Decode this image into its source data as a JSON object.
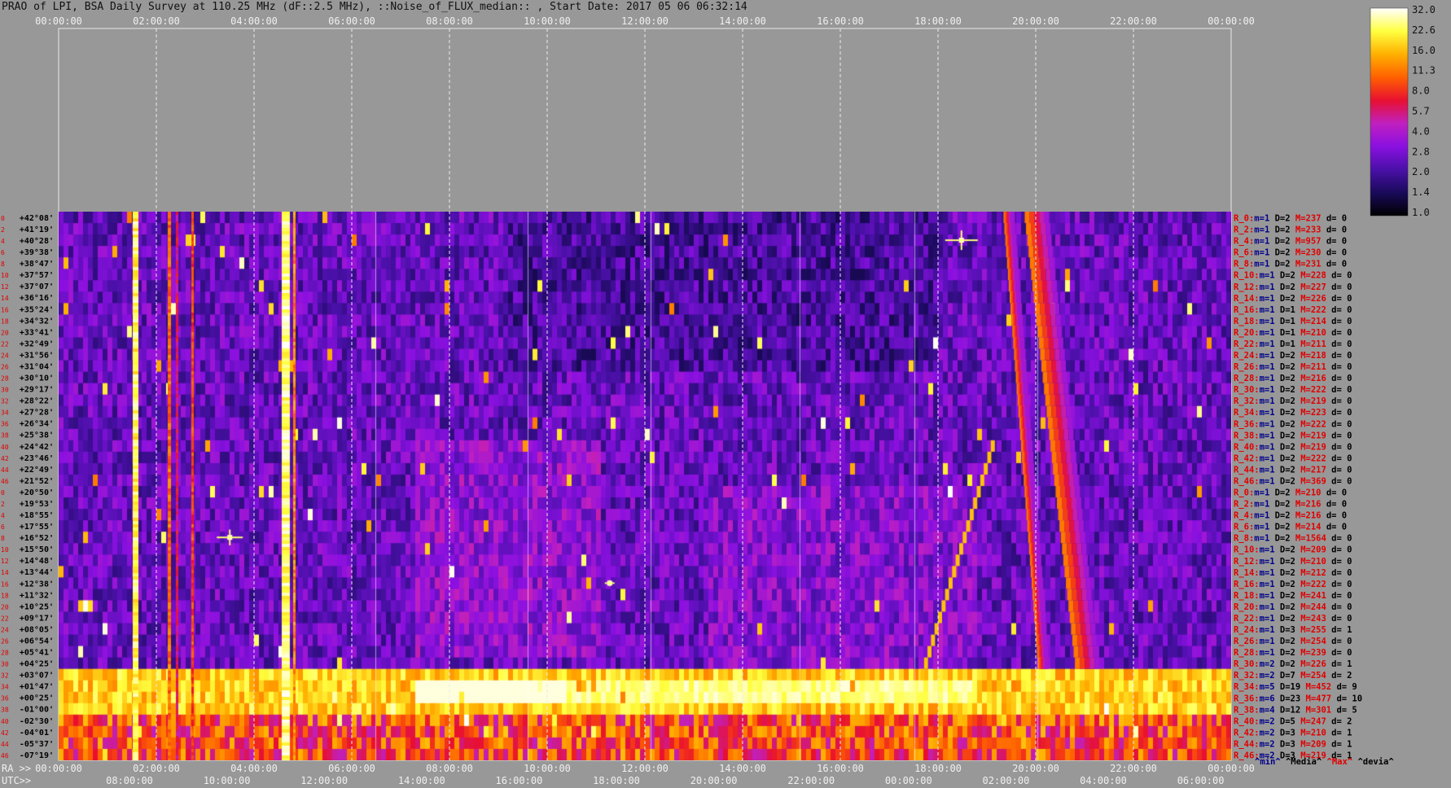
{
  "title": "PRAO of LPI, BSA Daily Survey at 110.25 MHz (dF::2.5 MHz), ::Noise_of_FLUX_median:: , Start Date: 2017 05 06 06:32:14",
  "top_axis_ticks": [
    "00:00:00",
    "02:00:00",
    "04:00:00",
    "06:00:00",
    "08:00:00",
    "10:00:00",
    "12:00:00",
    "14:00:00",
    "16:00:00",
    "18:00:00",
    "20:00:00",
    "22:00:00",
    "00:00:00"
  ],
  "ra_axis": {
    "label": "RA >>",
    "ticks": [
      "00:00:00",
      "02:00:00",
      "04:00:00",
      "06:00:00",
      "08:00:00",
      "10:00:00",
      "12:00:00",
      "14:00:00",
      "16:00:00",
      "18:00:00",
      "20:00:00",
      "22:00:00",
      "00:00:00"
    ]
  },
  "utc_axis": {
    "label": "UTC>>",
    "ticks": [
      "08:00:00",
      "10:00:00",
      "12:00:00",
      "14:00:00",
      "16:00:00",
      "18:00:00",
      "20:00:00",
      "22:00:00",
      "00:00:00",
      "02:00:00",
      "04:00:00",
      "06:00:00"
    ]
  },
  "colorbar": {
    "ticks": [
      "32.0",
      "22.6",
      "16.0",
      "11.3",
      "8.0",
      "5.7",
      "4.0",
      "2.8",
      "2.0",
      "1.4",
      "1.0"
    ],
    "colors": [
      "#000000",
      "#1a0a5a",
      "#4a10a8",
      "#8a10e0",
      "#c020c0",
      "#e81030",
      "#ff6000",
      "#ffb000",
      "#ffff40",
      "#ffffff"
    ]
  },
  "footer_legend": {
    "min": "^min^",
    "median": "^Media^",
    "max": "^Max^",
    "devia": "^devia^"
  },
  "chart_data": {
    "type": "heatmap",
    "title": "PRAO of LPI, BSA Daily Survey at 110.25 MHz (dF::2.5 MHz), ::Noise_of_FLUX_median:: , Start Date: 2017 05 06 06:32:14",
    "x_axis": "RA 00:00:00 to 24:00:00",
    "y_axis": "Declination, +42°08' to -07°19'",
    "value_range": [
      1.0,
      32.0
    ],
    "scale": "log",
    "declinations": [
      "+42°08'",
      "+41°19'",
      "+40°28'",
      "+39°38'",
      "+38°47'",
      "+37°57'",
      "+37°07'",
      "+36°16'",
      "+35°24'",
      "+34°32'",
      "+33°41'",
      "+32°49'",
      "+31°56'",
      "+31°04'",
      "+30°10'",
      "+29°17'",
      "+28°22'",
      "+27°28'",
      "+26°34'",
      "+25°38'",
      "+24°42'",
      "+23°46'",
      "+22°49'",
      "+21°52'",
      "+20°50'",
      "+19°53'",
      "+18°55'",
      "+17°55'",
      "+16°52'",
      "+15°50'",
      "+14°48'",
      "+13°44'",
      "+12°38'",
      "+11°32'",
      "+10°25'",
      "+09°17'",
      "+08°05'",
      "+06°54'",
      "+05°41'",
      "+04°25'",
      "+03°07'",
      "+01°47'",
      "+00°25'",
      "-01°00'",
      "-02°30'",
      "-04°01'",
      "-05°37'",
      "-07°19'"
    ],
    "row_numbers": [
      "0",
      "2",
      "4",
      "6",
      "8",
      "10",
      "12",
      "14",
      "16",
      "18",
      "20",
      "22",
      "24",
      "26",
      "28",
      "30",
      "32",
      "34",
      "36",
      "38",
      "40",
      "42",
      "44",
      "46",
      "0",
      "2",
      "4",
      "6",
      "8",
      "10",
      "12",
      "14",
      "16",
      "18",
      "20",
      "22",
      "24",
      "26",
      "28",
      "30",
      "32",
      "34",
      "36",
      "38",
      "40",
      "42",
      "44",
      "46"
    ],
    "row_stats": [
      {
        "r": "R_0:",
        "m": "m=1",
        "D": "D=2",
        "M": "M=237",
        "d": "d= 0"
      },
      {
        "r": "R_2:",
        "m": "m=1",
        "D": "D=2",
        "M": "M=233",
        "d": "d= 0"
      },
      {
        "r": "R_4:",
        "m": "m=1",
        "D": "D=2",
        "M": "M=957",
        "d": "d= 0"
      },
      {
        "r": "R_6:",
        "m": "m=1",
        "D": "D=2",
        "M": "M=230",
        "d": "d= 0"
      },
      {
        "r": "R_8:",
        "m": "m=1",
        "D": "D=2",
        "M": "M=231",
        "d": "d= 0"
      },
      {
        "r": "R_10:",
        "m": "m=1",
        "D": "D=2",
        "M": "M=228",
        "d": "d= 0"
      },
      {
        "r": "R_12:",
        "m": "m=1",
        "D": "D=2",
        "M": "M=227",
        "d": "d= 0"
      },
      {
        "r": "R_14:",
        "m": "m=1",
        "D": "D=2",
        "M": "M=226",
        "d": "d= 0"
      },
      {
        "r": "R_16:",
        "m": "m=1",
        "D": "D=1",
        "M": "M=222",
        "d": "d= 0"
      },
      {
        "r": "R_18:",
        "m": "m=1",
        "D": "D=1",
        "M": "M=214",
        "d": "d= 0"
      },
      {
        "r": "R_20:",
        "m": "m=1",
        "D": "D=1",
        "M": "M=210",
        "d": "d= 0"
      },
      {
        "r": "R_22:",
        "m": "m=1",
        "D": "D=1",
        "M": "M=211",
        "d": "d= 0"
      },
      {
        "r": "R_24:",
        "m": "m=1",
        "D": "D=2",
        "M": "M=218",
        "d": "d= 0"
      },
      {
        "r": "R_26:",
        "m": "m=1",
        "D": "D=2",
        "M": "M=211",
        "d": "d= 0"
      },
      {
        "r": "R_28:",
        "m": "m=1",
        "D": "D=2",
        "M": "M=216",
        "d": "d= 0"
      },
      {
        "r": "R_30:",
        "m": "m=1",
        "D": "D=2",
        "M": "M=222",
        "d": "d= 0"
      },
      {
        "r": "R_32:",
        "m": "m=1",
        "D": "D=2",
        "M": "M=219",
        "d": "d= 0"
      },
      {
        "r": "R_34:",
        "m": "m=1",
        "D": "D=2",
        "M": "M=223",
        "d": "d= 0"
      },
      {
        "r": "R_36:",
        "m": "m=1",
        "D": "D=2",
        "M": "M=222",
        "d": "d= 0"
      },
      {
        "r": "R_38:",
        "m": "m=1",
        "D": "D=2",
        "M": "M=219",
        "d": "d= 0"
      },
      {
        "r": "R_40:",
        "m": "m=1",
        "D": "D=2",
        "M": "M=219",
        "d": "d= 0"
      },
      {
        "r": "R_42:",
        "m": "m=1",
        "D": "D=2",
        "M": "M=222",
        "d": "d= 0"
      },
      {
        "r": "R_44:",
        "m": "m=1",
        "D": "D=2",
        "M": "M=217",
        "d": "d= 0"
      },
      {
        "r": "R_46:",
        "m": "m=1",
        "D": "D=2",
        "M": "M=369",
        "d": "d= 0"
      },
      {
        "r": "R_0:",
        "m": "m=1",
        "D": "D=2",
        "M": "M=210",
        "d": "d= 0"
      },
      {
        "r": "R_2:",
        "m": "m=1",
        "D": "D=2",
        "M": "M=216",
        "d": "d= 0"
      },
      {
        "r": "R_4:",
        "m": "m=1",
        "D": "D=2",
        "M": "M=216",
        "d": "d= 0"
      },
      {
        "r": "R_6:",
        "m": "m=1",
        "D": "D=2",
        "M": "M=214",
        "d": "d= 0"
      },
      {
        "r": "R_8:",
        "m": "m=1",
        "D": "D=2",
        "M": "M=1564",
        "d": "d= 0"
      },
      {
        "r": "R_10:",
        "m": "m=1",
        "D": "D=2",
        "M": "M=209",
        "d": "d= 0"
      },
      {
        "r": "R_12:",
        "m": "m=1",
        "D": "D=2",
        "M": "M=210",
        "d": "d= 0"
      },
      {
        "r": "R_14:",
        "m": "m=1",
        "D": "D=2",
        "M": "M=212",
        "d": "d= 0"
      },
      {
        "r": "R_16:",
        "m": "m=1",
        "D": "D=2",
        "M": "M=222",
        "d": "d= 0"
      },
      {
        "r": "R_18:",
        "m": "m=1",
        "D": "D=2",
        "M": "M=241",
        "d": "d= 0"
      },
      {
        "r": "R_20:",
        "m": "m=1",
        "D": "D=2",
        "M": "M=244",
        "d": "d= 0"
      },
      {
        "r": "R_22:",
        "m": "m=1",
        "D": "D=2",
        "M": "M=243",
        "d": "d= 0"
      },
      {
        "r": "R_24:",
        "m": "m=1",
        "D": "D=3",
        "M": "M=255",
        "d": "d= 1"
      },
      {
        "r": "R_26:",
        "m": "m=1",
        "D": "D=2",
        "M": "M=254",
        "d": "d= 0"
      },
      {
        "r": "R_28:",
        "m": "m=1",
        "D": "D=2",
        "M": "M=239",
        "d": "d= 0"
      },
      {
        "r": "R_30:",
        "m": "m=2",
        "D": "D=2",
        "M": "M=226",
        "d": "d= 1"
      },
      {
        "r": "R_32:",
        "m": "m=2",
        "D": "D=7",
        "M": "M=254",
        "d": "d= 2"
      },
      {
        "r": "R_34:",
        "m": "m=5",
        "D": "D=19",
        "M": "M=452",
        "d": "d= 9"
      },
      {
        "r": "R_36:",
        "m": "m=6",
        "D": "D=23",
        "M": "M=477",
        "d": "d= 10"
      },
      {
        "r": "R_38:",
        "m": "m=4",
        "D": "D=12",
        "M": "M=301",
        "d": "d= 5"
      },
      {
        "r": "R_40:",
        "m": "m=2",
        "D": "D=5",
        "M": "M=247",
        "d": "d= 2"
      },
      {
        "r": "R_42:",
        "m": "m=2",
        "D": "D=3",
        "M": "M=210",
        "d": "d= 1"
      },
      {
        "r": "R_44:",
        "m": "m=2",
        "D": "D=3",
        "M": "M=209",
        "d": "d= 1"
      },
      {
        "r": "R_46:",
        "m": "m=2",
        "D": "D=3",
        "M": "M=219",
        "d": "d= 1"
      }
    ]
  }
}
